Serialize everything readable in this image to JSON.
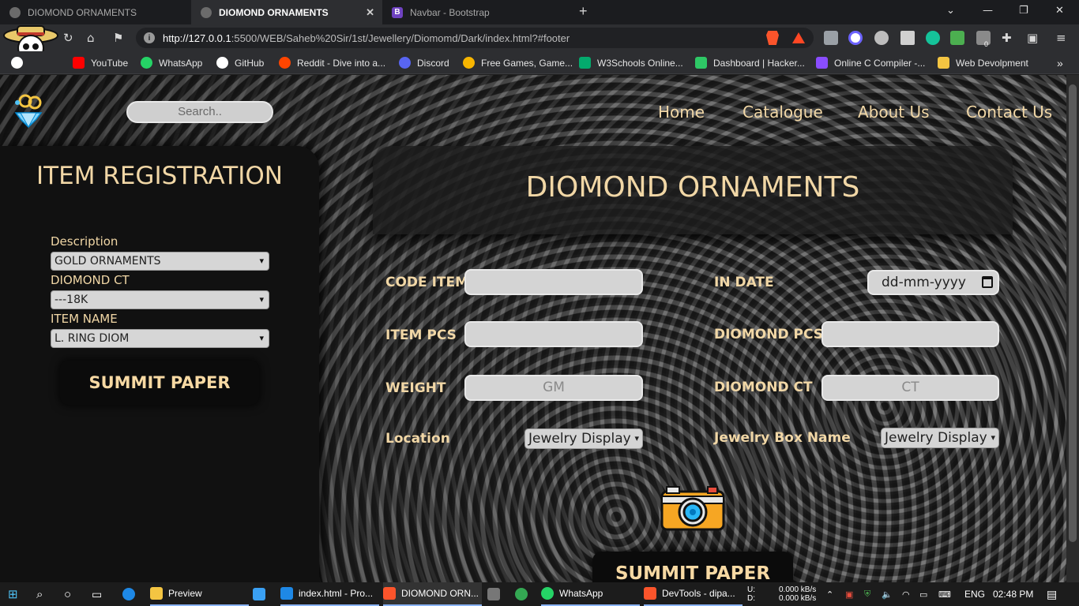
{
  "browser": {
    "tabs": [
      {
        "title": "DIOMOND ORNAMENTS",
        "active": false
      },
      {
        "title": "DIOMOND ORNAMENTS",
        "active": true
      },
      {
        "title": "Navbar - Bootstrap",
        "active": false
      }
    ],
    "new_tab_glyph": "+",
    "url_host": "http://127.0.0.1",
    "url_path": ":5500/WEB/Saheb%20Sir/1st/Jewellery/Diomomd/Dark/index.html?#footer",
    "extension_badge": "0",
    "bookmarks": [
      {
        "label": "YouTube",
        "icon": "youtube-icon",
        "color": "#ff0000"
      },
      {
        "label": "WhatsApp",
        "icon": "whatsapp-icon",
        "color": "#25d366"
      },
      {
        "label": "GitHub",
        "icon": "github-icon",
        "color": "#ffffff"
      },
      {
        "label": "Reddit - Dive into a...",
        "icon": "reddit-icon",
        "color": "#ff4500"
      },
      {
        "label": "Discord",
        "icon": "discord-icon",
        "color": "#5865f2"
      },
      {
        "label": "Free Games, Game...",
        "icon": "games-icon",
        "color": "#f7b500"
      },
      {
        "label": "W3Schools Online...",
        "icon": "w3schools-icon",
        "color": "#04aa6d"
      },
      {
        "label": "Dashboard | Hacker...",
        "icon": "hackerrank-icon",
        "color": "#2ec866"
      },
      {
        "label": "Online C Compiler -...",
        "icon": "compiler-icon",
        "color": "#8a4dff"
      },
      {
        "label": "Web Devolpment",
        "icon": "folder-icon",
        "color": "#f4c542"
      }
    ],
    "bookmarks_overflow": "»"
  },
  "page": {
    "search_placeholder": "Search..",
    "nav": [
      "Home",
      "Catalogue",
      "About Us",
      "Contact Us"
    ],
    "left": {
      "title": "ITEM REGISTRATION",
      "fields": [
        {
          "label": "Description",
          "value": "GOLD ORNAMENTS"
        },
        {
          "label": "DIOMOND CT",
          "value": "---18K"
        },
        {
          "label": "ITEM NAME",
          "value": "L. RING DIOM"
        }
      ],
      "submit": "SUMMIT PAPER"
    },
    "hero_title": "DIOMOND ORNAMENTS",
    "form": {
      "code_item": "CODE ITEM",
      "in_date": "IN DATE",
      "date_placeholder": "dd-mm-yyyy",
      "item_pcs": "ITEM PCS",
      "diomond_pcs": "DIOMOND PCS",
      "weight": "WEIGHT",
      "weight_placeholder": "GM",
      "diomond_ct": "DIOMOND CT",
      "diomond_ct_placeholder": "CT",
      "location": "Location",
      "location_value": "Jewelry Display",
      "box_name": "Jewelry Box Name",
      "box_value": "Jewelry Display",
      "submit": "SUMMIT PAPER"
    }
  },
  "taskbar": {
    "items": [
      {
        "label": "Preview",
        "icon": "file-icon"
      },
      {
        "label": "index.html - Pro...",
        "icon": "vscode-icon"
      },
      {
        "label": "DIOMOND ORN...",
        "icon": "brave-icon"
      },
      {
        "label": "WhatsApp",
        "icon": "whatsapp-icon"
      },
      {
        "label": "DevTools - dipa...",
        "icon": "brave-icon"
      }
    ],
    "net_up_label": "U:",
    "net_down_label": "D:",
    "net_up": "0.000 kB/s",
    "net_down": "0.000 kB/s",
    "language": "ENG",
    "time": "02:48 PM"
  },
  "colors": {
    "accent_text": "#f1d7a6",
    "panel_dark": "#111111",
    "input_bg": "#d4d4d4"
  }
}
